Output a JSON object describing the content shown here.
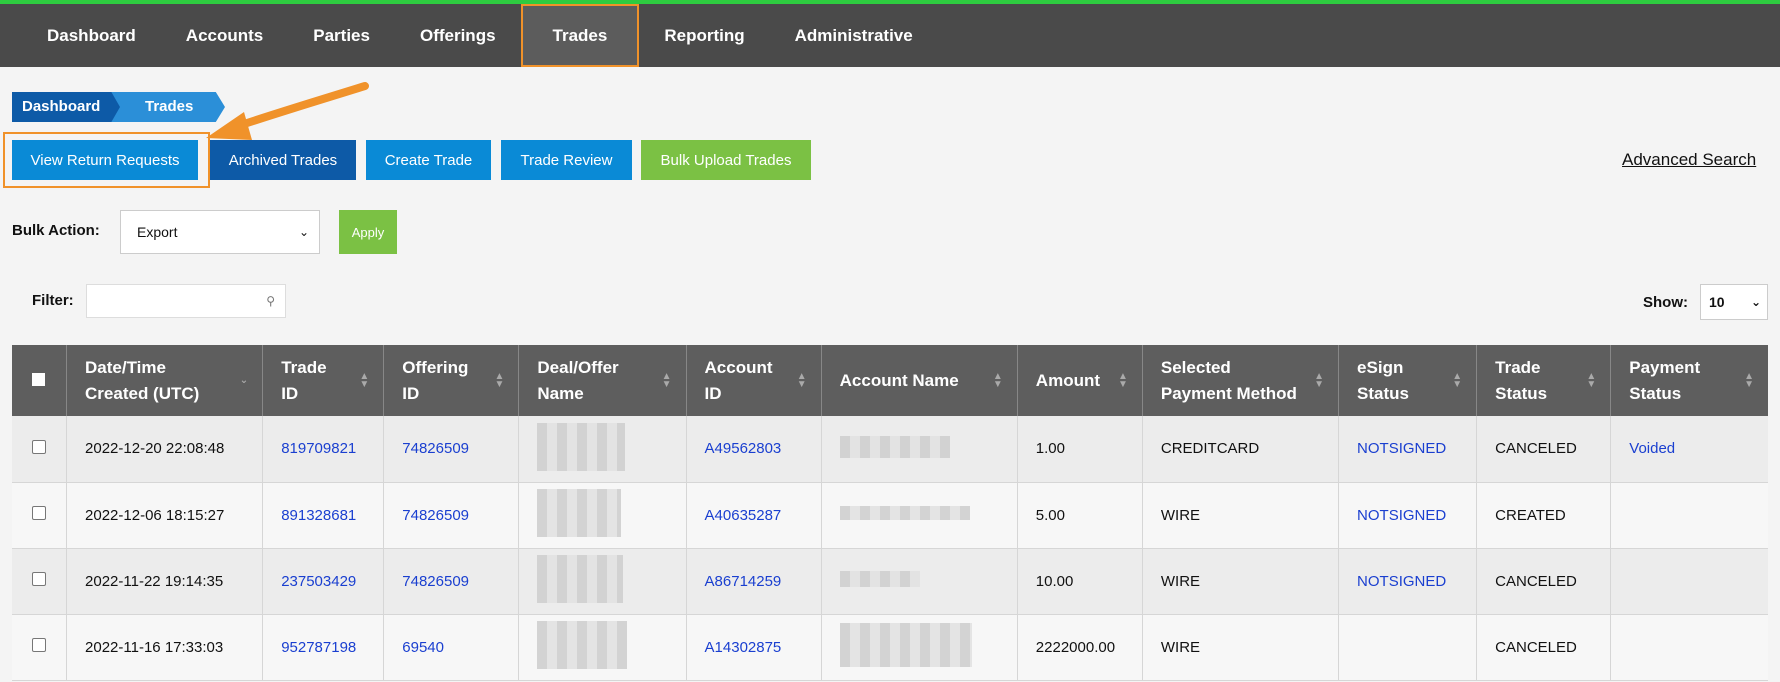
{
  "nav": {
    "items": [
      {
        "label": "Dashboard"
      },
      {
        "label": "Accounts"
      },
      {
        "label": "Parties"
      },
      {
        "label": "Offerings"
      },
      {
        "label": "Trades"
      },
      {
        "label": "Reporting"
      },
      {
        "label": "Administrative"
      }
    ],
    "active": "Trades"
  },
  "breadcrumb": [
    "Dashboard",
    "Trades"
  ],
  "actions": {
    "view_return_requests": "View Return Requests",
    "archived_trades": "Archived Trades",
    "create_trade": "Create Trade",
    "trade_review": "Trade Review",
    "bulk_upload_trades": "Bulk Upload Trades",
    "advanced_search": "Advanced Search"
  },
  "bulk_action": {
    "label": "Bulk Action:",
    "selected": "Export",
    "apply_label": "Apply"
  },
  "filter": {
    "label": "Filter:",
    "value": ""
  },
  "show": {
    "label": "Show:",
    "selected": "10"
  },
  "table": {
    "headers": [
      {
        "line1": "Date/Time",
        "line2": "Created (UTC)"
      },
      {
        "line1": "Trade",
        "line2": "ID"
      },
      {
        "line1": "Offering",
        "line2": "ID"
      },
      {
        "line1": "Deal/Offer",
        "line2": "Name"
      },
      {
        "line1": "Account",
        "line2": "ID"
      },
      {
        "line1": "Account Name",
        "line2": ""
      },
      {
        "line1": "Amount",
        "line2": ""
      },
      {
        "line1": "Selected",
        "line2": "Payment Method"
      },
      {
        "line1": "eSign",
        "line2": "Status"
      },
      {
        "line1": "Trade",
        "line2": "Status"
      },
      {
        "line1": "Payment",
        "line2": "Status"
      }
    ],
    "rows": [
      {
        "date": "2022-12-20 22:08:48",
        "trade_id": "819709821",
        "offering_id": "74826509",
        "account_id": "A49562803",
        "amount": "1.00",
        "payment_method": "CREDITCARD",
        "esign": "NOTSIGNED",
        "trade_status": "CANCELED",
        "payment_status": "Voided"
      },
      {
        "date": "2022-12-06 18:15:27",
        "trade_id": "891328681",
        "offering_id": "74826509",
        "account_id": "A40635287",
        "amount": "5.00",
        "payment_method": "WIRE",
        "esign": "NOTSIGNED",
        "trade_status": "CREATED",
        "payment_status": ""
      },
      {
        "date": "2022-11-22 19:14:35",
        "trade_id": "237503429",
        "offering_id": "74826509",
        "account_id": "A86714259",
        "amount": "10.00",
        "payment_method": "WIRE",
        "esign": "NOTSIGNED",
        "trade_status": "CANCELED",
        "payment_status": ""
      },
      {
        "date": "2022-11-16 17:33:03",
        "trade_id": "952787198",
        "offering_id": "69540",
        "account_id": "A14302875",
        "amount": "2222000.00",
        "payment_method": "WIRE",
        "esign": "",
        "trade_status": "CANCELED",
        "payment_status": ""
      }
    ]
  },
  "colors": {
    "nav_bg": "#4a4a4a",
    "highlight": "#f0922a",
    "primary_blue": "#0a8ad6",
    "dark_blue": "#0d5aa7",
    "green": "#7bc144",
    "link": "#1a3fd0"
  }
}
